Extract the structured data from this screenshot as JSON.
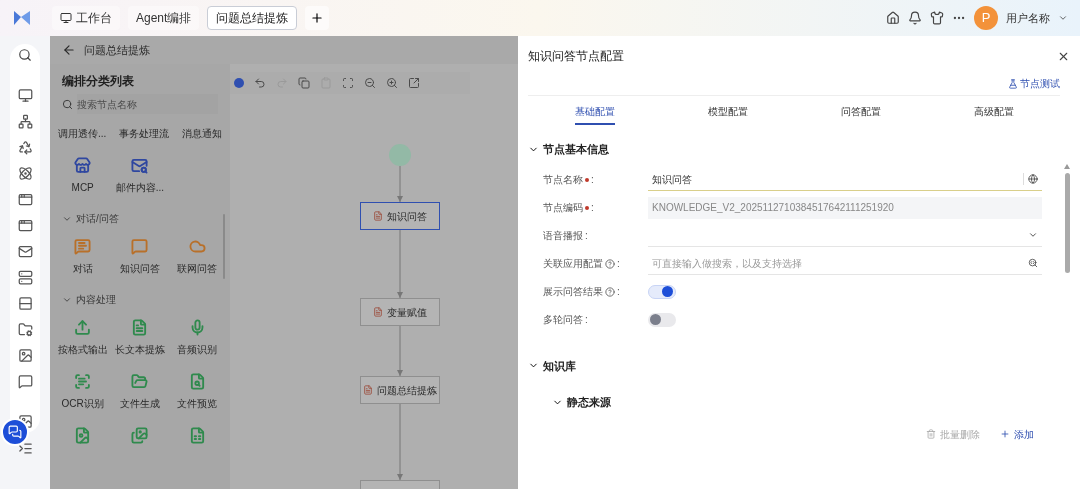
{
  "top_bar": {
    "tabs": [
      {
        "label": "工作台",
        "selected": false,
        "kind": "home"
      },
      {
        "label": "Agent编排",
        "selected": false,
        "kind": "plain"
      },
      {
        "label": "问题总结提炼",
        "selected": true,
        "kind": "plain"
      }
    ],
    "user": {
      "avatar_letter": "P",
      "name": "用户名称"
    }
  },
  "page_header": {
    "title": "问题总结提炼"
  },
  "node_panel": {
    "title": "编排分类列表",
    "search_placeholder": "搜索节点名称",
    "categories": [
      "调用透传...",
      "事务处理流",
      "消息通知"
    ],
    "groups": [
      {
        "color": "#2f47a0",
        "items": [
          {
            "label": "MCP",
            "kind": "labeled"
          },
          {
            "label": "邮件内容...",
            "kind": "labeled"
          }
        ]
      },
      {
        "title": "对话/问答",
        "expanded": true,
        "color": "#b8702a",
        "items": [
          {
            "label": "对话",
            "kind": "labeled"
          },
          {
            "label": "知识问答",
            "kind": "labeled"
          },
          {
            "label": "联网问答",
            "kind": "labeled"
          }
        ]
      },
      {
        "title": "内容处理",
        "expanded": true,
        "color": "#2f8a4d",
        "items": [
          {
            "label": "按格式输出",
            "kind": "labeled"
          },
          {
            "label": "长文本提炼",
            "kind": "labeled"
          },
          {
            "label": "音频识别",
            "kind": "labeled"
          },
          {
            "label": "OCR识别",
            "kind": "labeled"
          },
          {
            "label": "文件生成",
            "kind": "labeled"
          },
          {
            "label": "文件预览",
            "kind": "labeled"
          },
          {
            "kind": "icon_only"
          },
          {
            "kind": "icon_only"
          },
          {
            "kind": "icon_only"
          }
        ]
      }
    ]
  },
  "toolbar": [
    {
      "kind": "undo",
      "disabled": false
    },
    {
      "kind": "redo",
      "disabled": true
    },
    {
      "kind": "copy",
      "disabled": false
    },
    {
      "kind": "paste",
      "disabled": true
    },
    {
      "kind": "fit",
      "disabled": false
    },
    {
      "kind": "zoom_out",
      "disabled": false
    },
    {
      "kind": "zoom_in",
      "disabled": false
    },
    {
      "kind": "export",
      "disabled": false
    }
  ],
  "canvas": {
    "nodes": [
      {
        "kind": "start",
        "selected": false
      },
      {
        "kind": "node",
        "label": "知识问答",
        "selected": true
      },
      {
        "kind": "node",
        "label": "变量赋值",
        "selected": false
      },
      {
        "kind": "node",
        "label": "问题总结提炼",
        "selected": false
      },
      {
        "kind": "node",
        "selected": false
      }
    ]
  },
  "drawer": {
    "title": "知识问答节点配置",
    "test_button": "节点测试",
    "tabs": [
      {
        "label": "基础配置",
        "selected": true
      },
      {
        "label": "模型配置",
        "selected": false
      },
      {
        "label": "问答配置",
        "selected": false
      },
      {
        "label": "高级配置",
        "selected": false
      }
    ],
    "basic_section": {
      "title": "节点基本信息",
      "expanded": true,
      "fields": [
        {
          "kind": "text",
          "label": "节点名称",
          "colon": ":",
          "required": true,
          "help": false,
          "value": "知识问答"
        },
        {
          "kind": "readonly",
          "label": "节点编码",
          "colon": ":",
          "required": true,
          "help": false,
          "value": "KNOWLEDGE_V2_2025112710384517642111251920"
        },
        {
          "kind": "select",
          "label": "语音播报",
          "colon": ":",
          "required": false,
          "help": false
        },
        {
          "kind": "lookup",
          "label": "关联应用配置",
          "colon": ":",
          "required": false,
          "help": true,
          "placeholder": "可直接输入做搜索，以及支持选择"
        },
        {
          "kind": "switch",
          "label": "展示问答结果",
          "colon": ":",
          "required": false,
          "help": true,
          "on": true
        },
        {
          "kind": "switch",
          "label": "多轮问答",
          "colon": ":",
          "required": false,
          "help": false,
          "on": false
        }
      ]
    },
    "kb_section": {
      "title": "知识库",
      "expanded": true,
      "sub_title": "静态来源",
      "sub_expanded": true,
      "actions": [
        {
          "kind": "delete",
          "label": "批量删除",
          "disabled": true
        },
        {
          "kind": "add",
          "label": "添加",
          "disabled": false
        }
      ]
    }
  }
}
